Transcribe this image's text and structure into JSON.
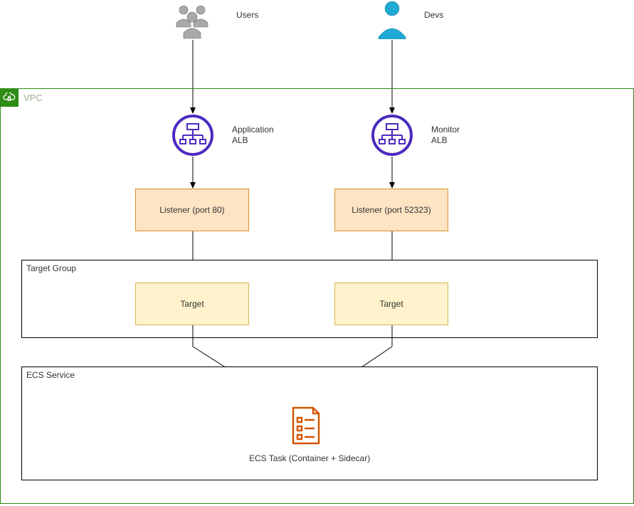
{
  "actors": {
    "users_label": "Users",
    "devs_label": "Devs"
  },
  "vpc": {
    "title": "VPC",
    "alb_app_label": "Application\nALB",
    "alb_monitor_label": "Monitor\nALB",
    "listener_app": "Listener (port 80)",
    "listener_monitor": "Listener (port 52323)",
    "target_group_title": "Target Group",
    "target_left": "Target",
    "target_right": "Target",
    "ecs_service_title": "ECS Service",
    "ecs_task_label": "ECS Task (Container + Sidecar)"
  },
  "icons": {
    "users": "users-icon",
    "dev": "person-icon",
    "vpc_cloud": "cloud-lock-icon",
    "alb": "load-balancer-icon",
    "ecs_task": "task-list-icon"
  }
}
